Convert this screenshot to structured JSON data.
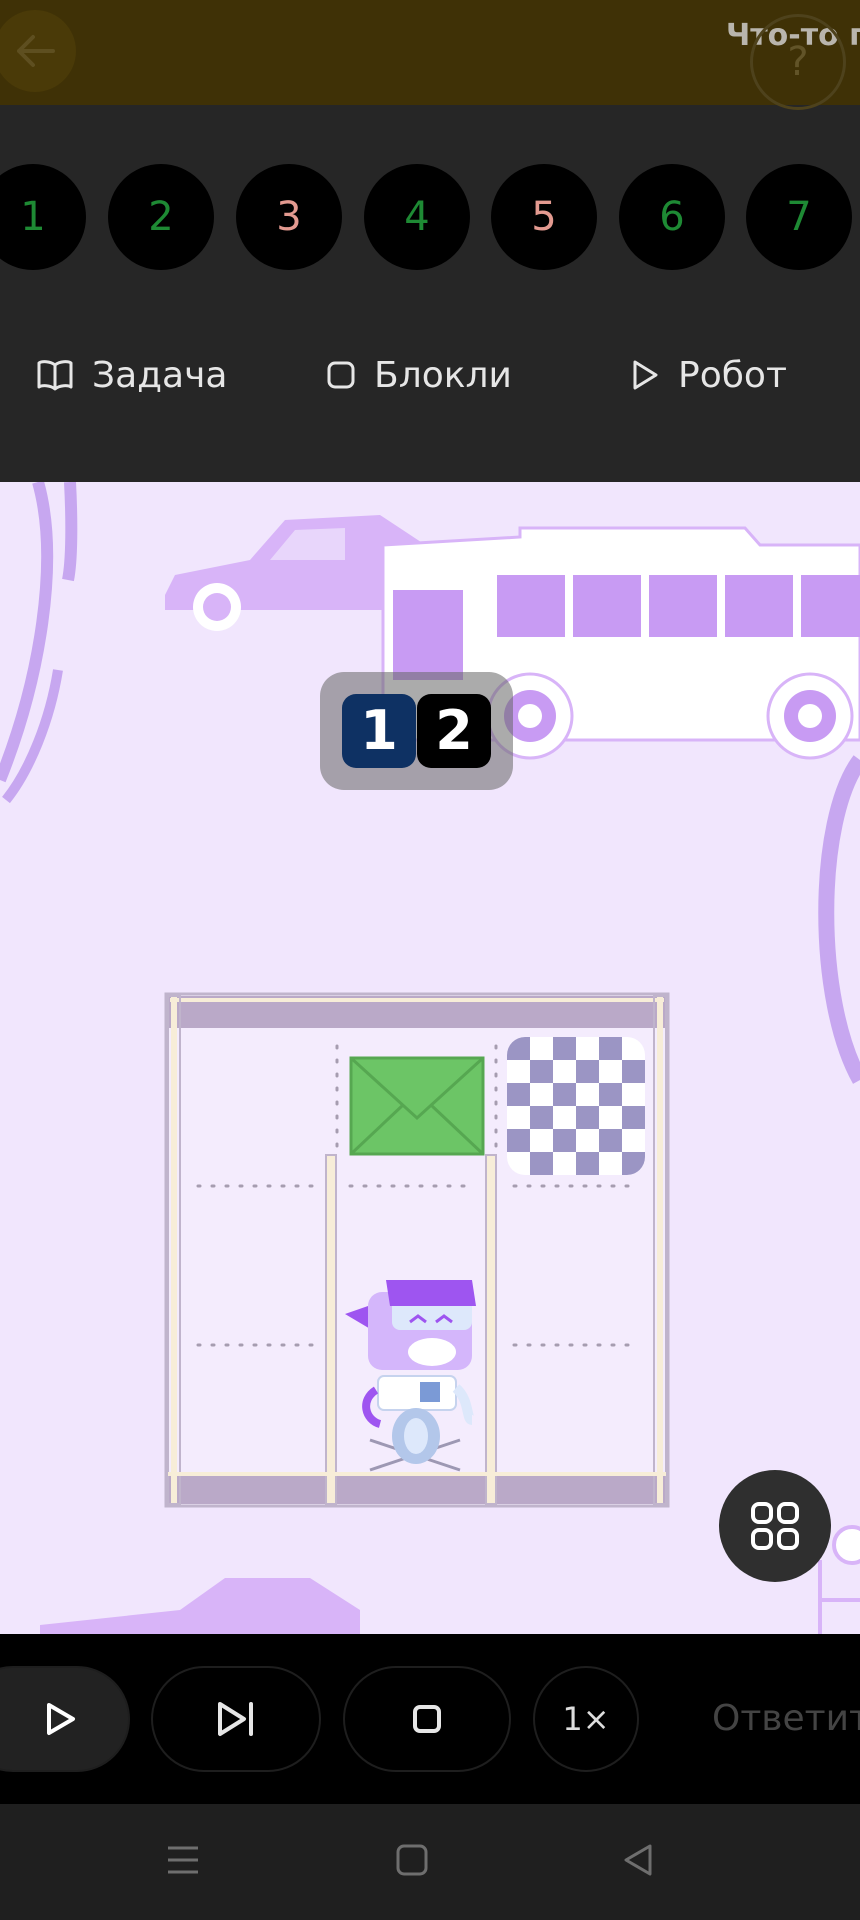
{
  "header": {
    "title": "Что-то п",
    "help_symbol": "?"
  },
  "levels": [
    {
      "label": "1",
      "color": "#1e8a34"
    },
    {
      "label": "2",
      "color": "#1e8a34"
    },
    {
      "label": "3",
      "color": "#e39a90"
    },
    {
      "label": "4",
      "color": "#1e8a34"
    },
    {
      "label": "5",
      "color": "#e39a90"
    },
    {
      "label": "6",
      "color": "#1e8a34"
    },
    {
      "label": "7",
      "color": "#1e8a34"
    }
  ],
  "tabs": {
    "task": "Задача",
    "blockly": "Блокли",
    "robot": "Робот"
  },
  "scene": {
    "counter": [
      "1",
      "2"
    ],
    "counter_colors": [
      "#0e3163",
      "#000000"
    ]
  },
  "controls": {
    "speed": "1×",
    "answer": "Ответит"
  },
  "icons": {
    "back": "arrow-left-icon",
    "help": "question-icon",
    "task": "book-icon",
    "blockly": "square-icon",
    "robot": "play-icon",
    "grid": "grid-icon",
    "run": "play-icon",
    "step": "step-forward-icon",
    "stop": "stop-icon",
    "menu": "menu-icon",
    "home": "home-icon",
    "back_nav": "triangle-back-icon"
  }
}
